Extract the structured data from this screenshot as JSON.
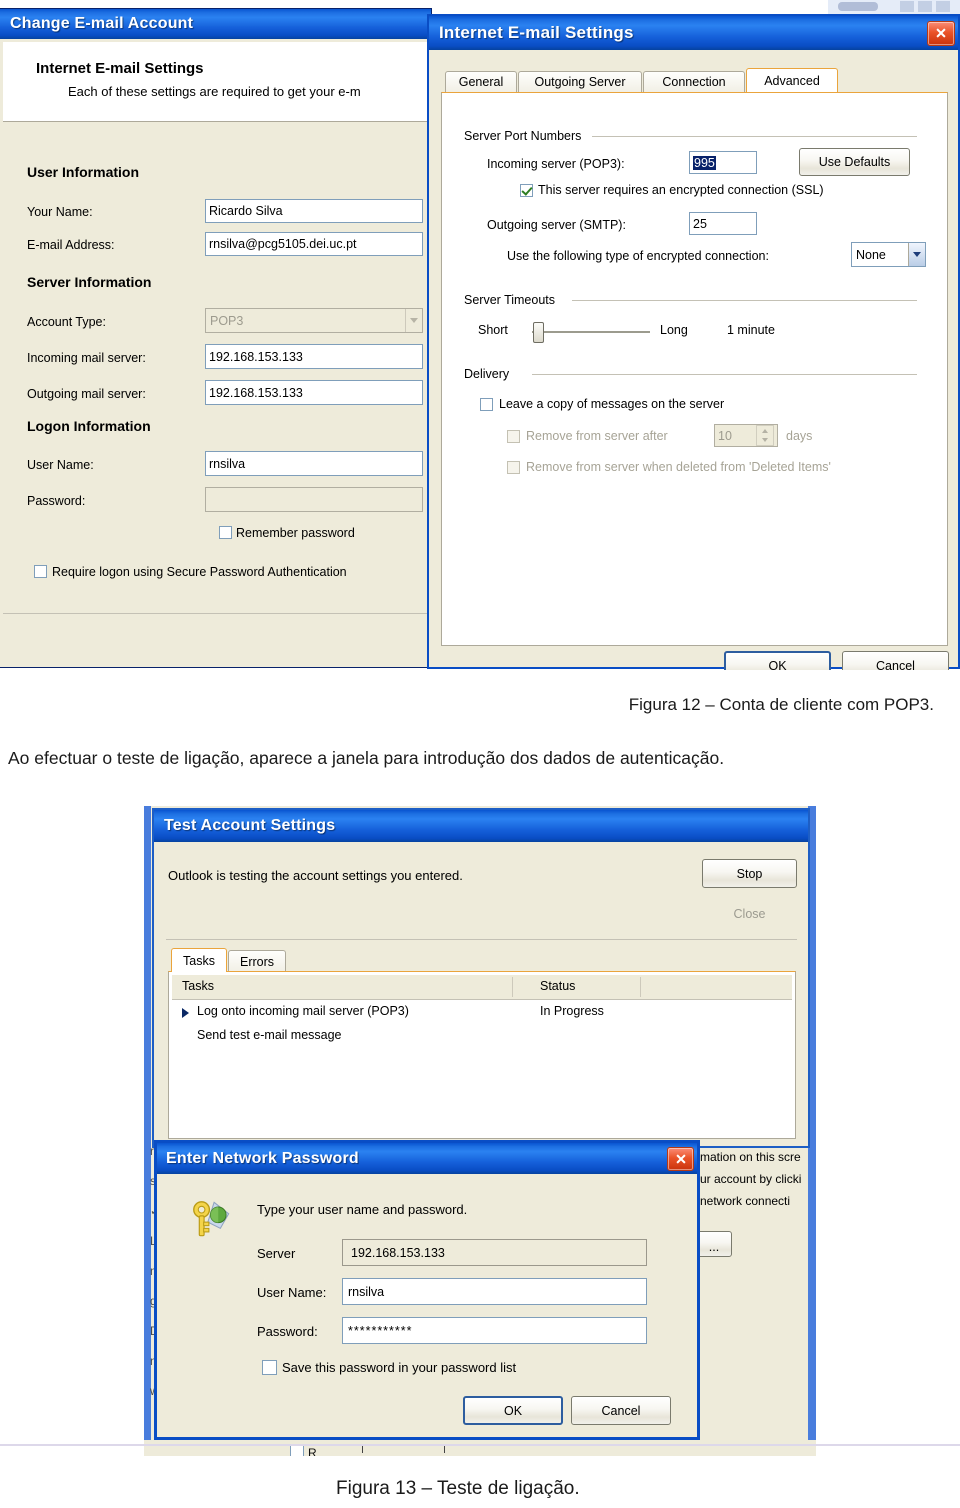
{
  "page": {
    "figure12_caption": "Figura 12 – Conta de cliente com POP3.",
    "body_text": "Ao efectuar o teste de ligação, aparece a janela para introdução dos dados de autenticação.",
    "figure13_caption": "Figura 13 – Teste de ligação."
  },
  "colors": {
    "title_blue": "#0b56cf",
    "dialog_face": "#ece9d8",
    "field_white": "#ffffff",
    "close_red": "#c8340e",
    "tab_selected_orange": "#e8a33d",
    "ssl_check_green": "#2f7d23"
  },
  "change_account_dialog": {
    "title": "Change E-mail Account",
    "header_title": "Internet E-mail Settings",
    "header_subtitle": "Each of these settings are required to get your e-m",
    "sections": {
      "user_information": "User Information",
      "server_information": "Server Information",
      "logon_information": "Logon Information"
    },
    "fields": [
      {
        "label": "Your Name:",
        "value": "Ricardo Silva"
      },
      {
        "label": "E-mail Address:",
        "value": "rnsilva@pcg5105.dei.uc.pt"
      },
      {
        "label": "Account Type:",
        "value": "POP3"
      },
      {
        "label": "Incoming mail server:",
        "value": "192.168.153.133"
      },
      {
        "label": "Outgoing mail server:",
        "value": "192.168.153.133"
      },
      {
        "label": "User Name:",
        "value": "rnsilva"
      },
      {
        "label": "Password:",
        "value": ""
      }
    ],
    "checkboxes": [
      {
        "label": "Remember password",
        "checked": false
      },
      {
        "label": "Require logon using Secure Password Authentication",
        "checked": false
      }
    ]
  },
  "internet_email_settings_dialog": {
    "title": "Internet E-mail Settings",
    "tabs": [
      {
        "label": "General",
        "selected": false
      },
      {
        "label": "Outgoing Server",
        "selected": false
      },
      {
        "label": "Connection",
        "selected": false
      },
      {
        "label": "Advanced",
        "selected": true
      }
    ],
    "groups": {
      "server_port_numbers": "Server Port Numbers",
      "server_timeouts": "Server Timeouts",
      "delivery": "Delivery"
    },
    "ports": {
      "incoming_label": "Incoming server (POP3):",
      "incoming_value": "995",
      "use_defaults_button": "Use Defaults",
      "ssl_checkbox_label": "This server requires an encrypted connection (SSL)",
      "ssl_checked": true,
      "outgoing_label": "Outgoing server (SMTP):",
      "outgoing_value": "25",
      "encryption_label": "Use the following type of encrypted connection:",
      "encryption_value": "None"
    },
    "timeouts": {
      "short_label": "Short",
      "long_label": "Long",
      "value_label": "1 minute"
    },
    "delivery": {
      "leave_copy": "Leave a copy of messages on the server",
      "leave_copy_checked": false,
      "remove_after_prefix": "Remove from server after",
      "remove_after_days_value": "10",
      "remove_after_suffix": "days",
      "remove_after_checked": false,
      "remove_when_deleted": "Remove from server when deleted from 'Deleted Items'",
      "remove_when_deleted_checked": false
    },
    "buttons": {
      "ok": "OK",
      "cancel": "Cancel"
    }
  },
  "test_account_settings_dialog": {
    "title": "Test Account Settings",
    "status_text": "Outlook is testing the account settings you entered.",
    "stop_button": "Stop",
    "close_button": "Close",
    "tabs": [
      {
        "label": "Tasks",
        "selected": true
      },
      {
        "label": "Errors",
        "selected": false
      }
    ],
    "columns": [
      "Tasks",
      "Status"
    ],
    "rows": [
      {
        "task": "Log onto incoming mail server (POP3)",
        "status": "In Progress",
        "marker": true
      },
      {
        "task": "Send test e-mail message",
        "status": "",
        "marker": false
      }
    ]
  },
  "background_window_text": {
    "line1": "mation on this scre",
    "line2": "ur account by clicki",
    "line3": "network connecti",
    "ellipsis_button": "..."
  },
  "enter_network_password_dialog": {
    "title": "Enter Network Password",
    "prompt": "Type your user name and password.",
    "icon": "key-globe-icon",
    "fields": [
      {
        "label": "Server",
        "value": "192.168.153.133",
        "readonly": true
      },
      {
        "label": "User Name:",
        "value": "rnsilva",
        "readonly": false
      },
      {
        "label": "Password:",
        "value": "***********",
        "readonly": false
      }
    ],
    "save_password_checkbox": {
      "label": "Save this password in your password list",
      "checked": false
    },
    "buttons": {
      "ok": "OK",
      "cancel": "Cancel"
    }
  }
}
